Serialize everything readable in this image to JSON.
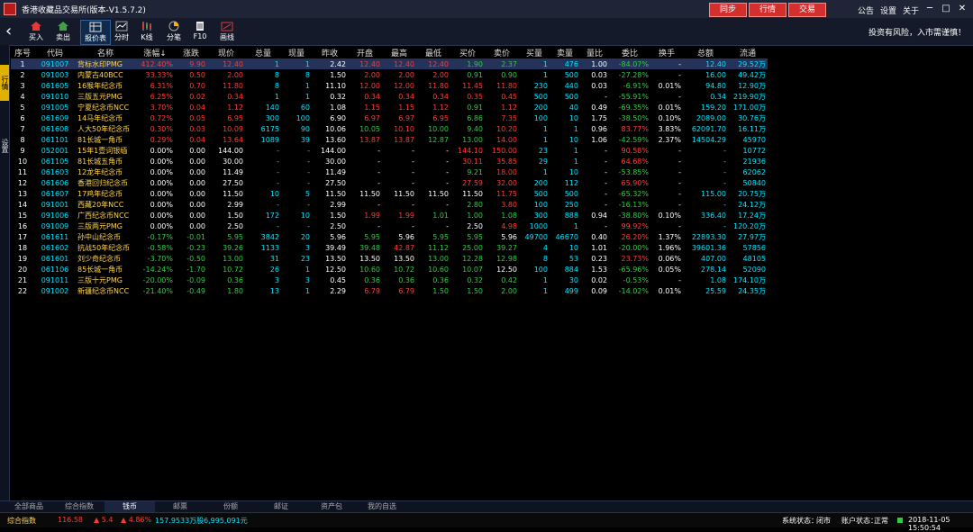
{
  "window": {
    "title": "香港收藏品交易所(版本-V1.5.7.2)",
    "buttons": [
      "同步",
      "行情",
      "交易"
    ],
    "links": [
      "公告",
      "设置",
      "关于"
    ],
    "controls": [
      "─",
      "□",
      "✕"
    ]
  },
  "toolbar": {
    "items": [
      "买入",
      "卖出",
      "报价表",
      "分时",
      "K线",
      "分笔",
      "F10",
      "画线"
    ],
    "risk_notice": "投资有风险，入市需谨慎！"
  },
  "sidebar": [
    "行情",
    "设置"
  ],
  "table": {
    "columns": [
      "序号",
      "代码",
      "名称",
      "涨幅↓",
      "涨跌",
      "现价",
      "总量",
      "现量",
      "昨收",
      "开盘",
      "最高",
      "最低",
      "买价",
      "卖价",
      "买量",
      "卖量",
      "量比",
      "委比",
      "换手",
      "总额",
      "流通"
    ],
    "rows": [
      [
        "1",
        "091007",
        "背标水印PMG",
        "412.40%",
        "9.90",
        "12.40",
        "1",
        "1",
        "2.42",
        "12.40",
        "12.40",
        "12.40",
        "1.90",
        "2.37",
        "1",
        "476",
        "1.00",
        "-84.07%",
        "-",
        "12.40",
        "29.52万"
      ],
      [
        "2",
        "091003",
        "内蒙古40BCC",
        "33.33%",
        "0.50",
        "2.00",
        "8",
        "8",
        "1.50",
        "2.00",
        "2.00",
        "2.00",
        "0.91",
        "0.90",
        "1",
        "500",
        "0.03",
        "-27.28%",
        "-",
        "16.00",
        "49.42万"
      ],
      [
        "3",
        "061605",
        "16猴年纪念币",
        "6.31%",
        "0.70",
        "11.80",
        "8",
        "1",
        "11.10",
        "12.00",
        "12.00",
        "11.80",
        "11.45",
        "11.80",
        "230",
        "440",
        "0.03",
        "-6.91%",
        "0.01%",
        "94.80",
        "12.90万"
      ],
      [
        "4",
        "091010",
        "三版五元PMG",
        "6.25%",
        "0.02",
        "0.34",
        "1",
        "1",
        "0.32",
        "0.34",
        "0.34",
        "0.34",
        "0.35",
        "0.45",
        "500",
        "500",
        "-",
        "-55.91%",
        "-",
        "0.34",
        "219.90万"
      ],
      [
        "5",
        "091005",
        "宁夏纪念币NCC",
        "3.70%",
        "0.04",
        "1.12",
        "140",
        "60",
        "1.08",
        "1.15",
        "1.15",
        "1.12",
        "0.91",
        "1.12",
        "200",
        "40",
        "0.49",
        "-69.35%",
        "0.01%",
        "159.20",
        "171.00万"
      ],
      [
        "6",
        "061609",
        "14马年纪念币",
        "0.72%",
        "0.05",
        "6.95",
        "300",
        "100",
        "6.90",
        "6.97",
        "6.97",
        "6.95",
        "6.86",
        "7.35",
        "100",
        "10",
        "1.75",
        "-38.50%",
        "0.10%",
        "2089.00",
        "30.76万"
      ],
      [
        "7",
        "061608",
        "人大50年纪念币",
        "0.30%",
        "0.03",
        "10.09",
        "6175",
        "90",
        "10.06",
        "10.05",
        "10.10",
        "10.00",
        "9.40",
        "10.20",
        "1",
        "1",
        "0.96",
        "83.77%",
        "3.83%",
        "62091.70",
        "16.11万"
      ],
      [
        "8",
        "061101",
        "81长城一角币",
        "0.29%",
        "0.04",
        "13.64",
        "1089",
        "39",
        "13.60",
        "13.87",
        "13.87",
        "12.87",
        "13.00",
        "14.00",
        "1",
        "10",
        "1.06",
        "-42.59%",
        "2.37%",
        "14504.29",
        "45970"
      ],
      [
        "9",
        "052001",
        "15年1壹词银缅",
        "0.00%",
        "0.00",
        "144.00",
        "-",
        "-",
        "144.00",
        "-",
        "-",
        "-",
        "144.10",
        "150.00",
        "23",
        "1",
        "-",
        "90.58%",
        "-",
        "-",
        "10772"
      ],
      [
        "10",
        "061105",
        "81长城五角币",
        "0.00%",
        "0.00",
        "30.00",
        "-",
        "-",
        "30.00",
        "-",
        "-",
        "-",
        "30.11",
        "35.85",
        "29",
        "1",
        "-",
        "64.68%",
        "-",
        "-",
        "21936"
      ],
      [
        "11",
        "061603",
        "12龙年纪念币",
        "0.00%",
        "0.00",
        "11.49",
        "-",
        "-",
        "11.49",
        "-",
        "-",
        "-",
        "9.21",
        "18.00",
        "1",
        "10",
        "-",
        "-53.85%",
        "-",
        "-",
        "62062"
      ],
      [
        "12",
        "061606",
        "香港回归纪念币",
        "0.00%",
        "0.00",
        "27.50",
        "-",
        "-",
        "27.50",
        "-",
        "-",
        "-",
        "27.59",
        "32.00",
        "200",
        "112",
        "-",
        "65.90%",
        "-",
        "-",
        "50840"
      ],
      [
        "13",
        "061607",
        "17鸡年纪念币",
        "0.00%",
        "0.00",
        "11.50",
        "10",
        "5",
        "11.50",
        "11.50",
        "11.50",
        "11.50",
        "11.50",
        "11.75",
        "500",
        "500",
        "-",
        "-65.32%",
        "-",
        "115.00",
        "20.75万"
      ],
      [
        "14",
        "091001",
        "西藏20年NCC",
        "0.00%",
        "0.00",
        "2.99",
        "-",
        "-",
        "2.99",
        "-",
        "-",
        "-",
        "2.80",
        "3.80",
        "100",
        "250",
        "-",
        "-16.13%",
        "-",
        "-",
        "24.12万"
      ],
      [
        "15",
        "091006",
        "广西纪念币NCC",
        "0.00%",
        "0.00",
        "1.50",
        "172",
        "10",
        "1.50",
        "1.99",
        "1.99",
        "1.01",
        "1.00",
        "1.08",
        "300",
        "888",
        "0.94",
        "-38.80%",
        "0.10%",
        "336.40",
        "17.24万"
      ],
      [
        "16",
        "091009",
        "三版两元PMG",
        "0.00%",
        "0.00",
        "2.50",
        "-",
        "-",
        "2.50",
        "-",
        "-",
        "-",
        "2.50",
        "4.98",
        "1000",
        "1",
        "-",
        "99.92%",
        "-",
        "-",
        "120.20万"
      ],
      [
        "17",
        "061611",
        "孙中山纪念币",
        "-0.17%",
        "-0.01",
        "5.95",
        "3842",
        "20",
        "5.96",
        "5.95",
        "5.96",
        "5.95",
        "5.95",
        "5.96",
        "49700",
        "46670",
        "0.40",
        "26.20%",
        "1.37%",
        "22893.30",
        "27.97万"
      ],
      [
        "18",
        "061602",
        "抗战50年纪念币",
        "-0.58%",
        "-0.23",
        "39.26",
        "1133",
        "3",
        "39.49",
        "39.48",
        "42.87",
        "11.12",
        "25.00",
        "39.27",
        "4",
        "10",
        "1.01",
        "-20.00%",
        "1.96%",
        "39601.36",
        "57856"
      ],
      [
        "19",
        "061601",
        "刘少奇纪念币",
        "-3.70%",
        "-0.50",
        "13.00",
        "31",
        "23",
        "13.50",
        "13.50",
        "13.50",
        "13.00",
        "12.28",
        "12.98",
        "8",
        "53",
        "0.23",
        "23.73%",
        "0.06%",
        "407.00",
        "48105"
      ],
      [
        "20",
        "061106",
        "85长城一角币",
        "-14.24%",
        "-1.70",
        "10.72",
        "26",
        "1",
        "12.50",
        "10.60",
        "10.72",
        "10.60",
        "10.07",
        "12.50",
        "100",
        "884",
        "1.53",
        "-65.96%",
        "0.05%",
        "278.14",
        "52090"
      ],
      [
        "21",
        "091011",
        "三版十元PMG",
        "-20.00%",
        "-0.09",
        "0.36",
        "3",
        "3",
        "0.45",
        "0.36",
        "0.36",
        "0.36",
        "0.32",
        "0.42",
        "1",
        "30",
        "0.02",
        "-0.53%",
        "-",
        "1.08",
        "174.10万"
      ],
      [
        "22",
        "091002",
        "新疆纪念币NCC",
        "-21.40%",
        "-0.49",
        "1.80",
        "13",
        "1",
        "2.29",
        "6.79",
        "6.79",
        "1.50",
        "1.50",
        "2.00",
        "1",
        "499",
        "0.09",
        "-14.02%",
        "0.01%",
        "25.59",
        "24.35万"
      ]
    ]
  },
  "tabs": [
    "全部商品",
    "综合指数",
    "钱币",
    "邮票",
    "份额",
    "邮证",
    "资产包",
    "我的自选"
  ],
  "active_tab": "钱币",
  "status": {
    "index_label": "综合指数",
    "index_value": "116.58",
    "change": "▲ 5.4",
    "pct": "▲ 4.86%",
    "volume": "157.9533万股",
    "amount": "6,995,091元",
    "system_label": "系统状态：",
    "system_value": "闭市",
    "account_label": "账户状态：",
    "account_value": "正常",
    "datetime": "2018-11-05 15:50:54"
  }
}
